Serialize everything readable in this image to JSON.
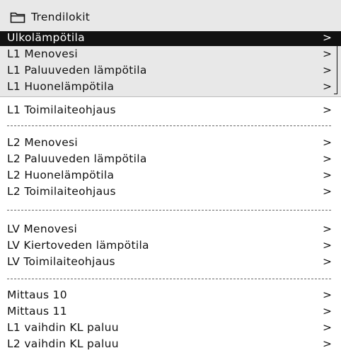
{
  "window": {
    "title": "Trendilokit",
    "title_icon": "folder-icon"
  },
  "chevron": ">",
  "items": [
    {
      "label": "Ulkolämpötila"
    },
    {
      "label": "L1 Menovesi"
    },
    {
      "label": "L1 Paluuveden lämpötila"
    },
    {
      "label": "L1 Huonelämpötila"
    },
    {
      "label": "L1 Toimilaiteohjaus"
    },
    {
      "label": "L2 Menovesi"
    },
    {
      "label": "L2 Paluuveden lämpötila"
    },
    {
      "label": "L2 Huonelämpötila"
    },
    {
      "label": "L2 Toimilaiteohjaus"
    },
    {
      "label": "LV Menovesi"
    },
    {
      "label": "LV Kiertoveden lämpötila"
    },
    {
      "label": "LV Toimilaiteohjaus"
    },
    {
      "label": "Mittaus 10"
    },
    {
      "label": "Mittaus 11"
    },
    {
      "label": "L1 vaihdin KL paluu"
    },
    {
      "label": "L2 vaihdin KL paluu"
    }
  ]
}
